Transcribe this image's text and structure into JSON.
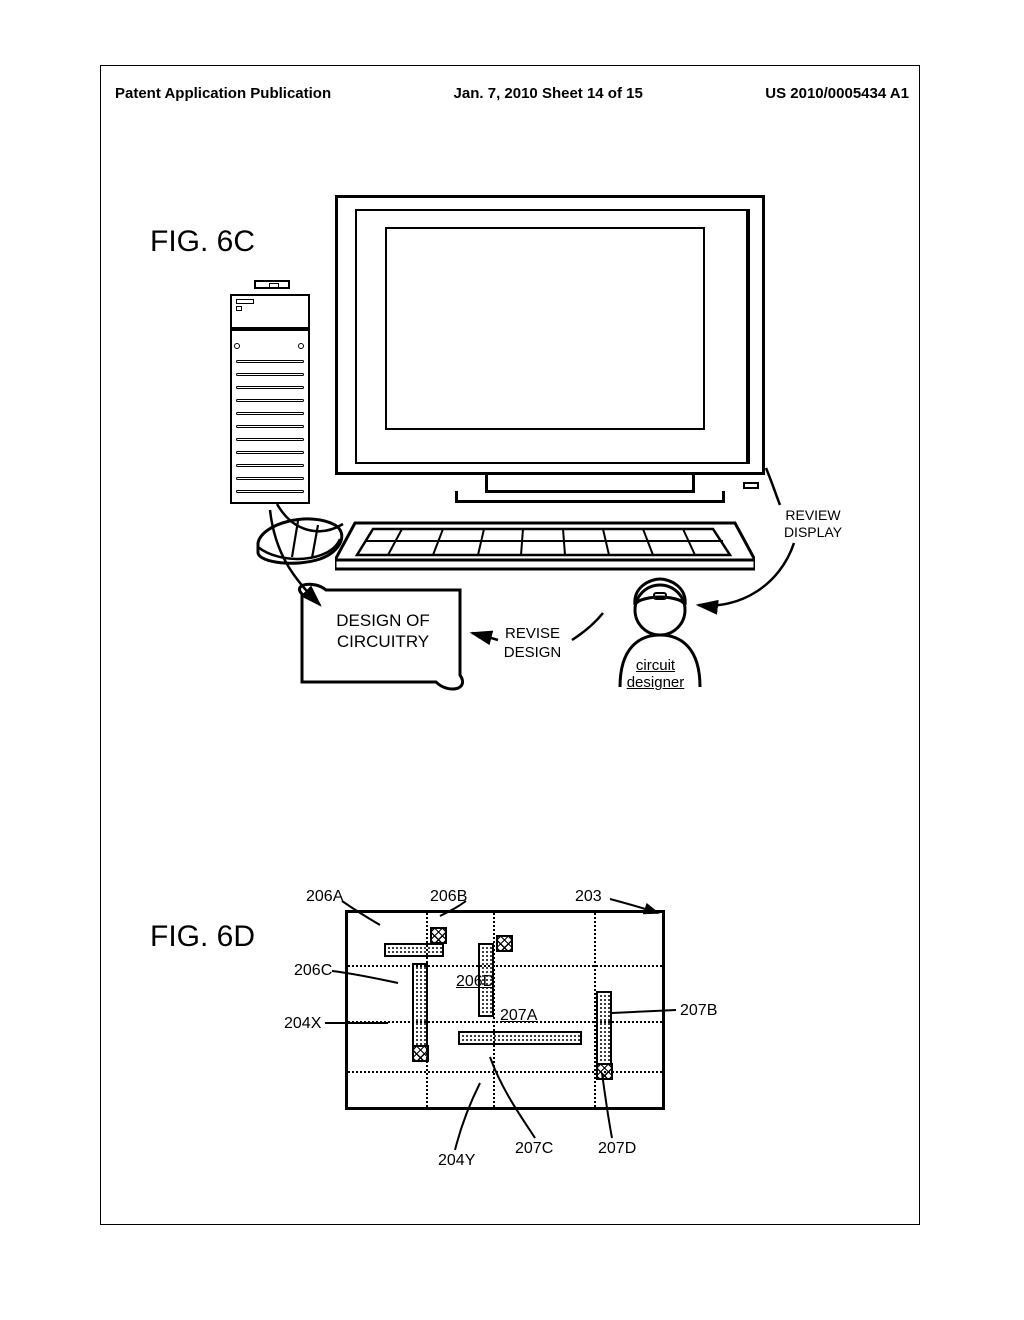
{
  "header": {
    "left": "Patent Application Publication",
    "center": "Jan. 7, 2010  Sheet 14 of 15",
    "right": "US 2010/0005434 A1"
  },
  "fig6c": {
    "label": "FIG.  6C",
    "design_text": "DESIGN OF CIRCUITRY",
    "revise_text": "REVISE DESIGN",
    "review_text": "REVIEW DISPLAY",
    "person_label": "circuit designer"
  },
  "fig6d": {
    "label": "FIG.  6D",
    "refs": {
      "r206A": "206A",
      "r206B": "206B",
      "r203": "203",
      "r206C": "206C",
      "r206D": "206D",
      "r207A": "207A",
      "r207B": "207B",
      "r204X": "204X",
      "r207C": "207C",
      "r207D": "207D",
      "r204Y": "204Y"
    }
  }
}
